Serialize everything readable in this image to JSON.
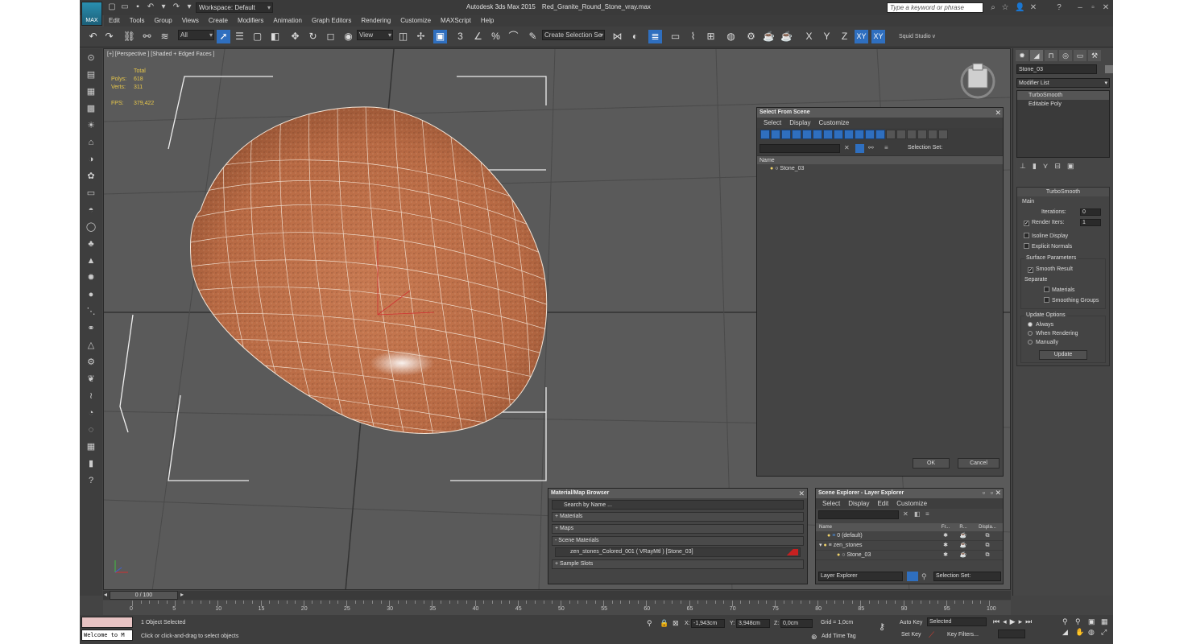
{
  "app": {
    "title": "Autodesk 3ds Max  2015",
    "file": "Red_Granite_Round_Stone_vray.max",
    "workspace": "Workspace: Default",
    "search_placeholder": "Type a keyword or phrase",
    "logo": "MAX"
  },
  "menu": [
    "Edit",
    "Tools",
    "Group",
    "Views",
    "Create",
    "Modifiers",
    "Animation",
    "Graph Editors",
    "Rendering",
    "Customize",
    "MAXScript",
    "Help"
  ],
  "toolbar": {
    "filter": "All",
    "refcoord": "View",
    "selset_placeholder": "Create Selection Se",
    "studio": "Squid Studio v",
    "axes": [
      "X",
      "Y",
      "Z",
      "XY",
      "XY"
    ]
  },
  "viewport": {
    "label": "[+] [Perspective ] [Shaded + Edged Faces ]",
    "stats_header": "Total",
    "polys_label": "Polys:",
    "polys": "618",
    "verts_label": "Verts:",
    "verts": "311",
    "fps_label": "FPS:",
    "fps": "379,422"
  },
  "select_scene": {
    "title": "Select From Scene",
    "menu": [
      "Select",
      "Display",
      "Customize"
    ],
    "selection_set": "Selection Set:",
    "col_name": "Name",
    "items": [
      "Stone_03"
    ],
    "ok": "OK",
    "cancel": "Cancel"
  },
  "material_browser": {
    "title": "Material/Map Browser",
    "search": "Search by Name ...",
    "sections": [
      "+ Materials",
      "+ Maps",
      "- Scene Materials"
    ],
    "scene_material": "zen_stones_Colored_001  ( VRayMtl )  [Stone_03]",
    "sample_slots": "+ Sample Slots"
  },
  "scene_explorer": {
    "title": "Scene Explorer - Layer Explorer",
    "menu": [
      "Select",
      "Display",
      "Edit",
      "Customize"
    ],
    "cols": [
      "Name",
      "Fr...",
      "R...",
      "Displa..."
    ],
    "rows": [
      "0 (default)",
      "zen_stones",
      "Stone_03"
    ],
    "footer_combo": "Layer Explorer",
    "footer_sel": "Selection Set:"
  },
  "command_panel": {
    "object_name": "Stone_03",
    "modifier_list": "Modifier List",
    "stack": [
      "TurboSmooth",
      "Editable Poly"
    ],
    "rollout_title": "TurboSmooth",
    "main": "Main",
    "iterations_label": "Iterations:",
    "iterations": "0",
    "render_iters_label": "Render Iters:",
    "render_iters": "1",
    "isoline": "Isoline Display",
    "explicit": "Explicit Normals",
    "surface_params": "Surface Parameters",
    "smooth_result": "Smooth Result",
    "separate": "Separate",
    "materials": "Materials",
    "smoothing_groups": "Smoothing Groups",
    "update_options": "Update Options",
    "always": "Always",
    "when_rendering": "When Rendering",
    "manually": "Manually",
    "update": "Update"
  },
  "timeline": {
    "slider": "0 / 100",
    "ticks": [
      "0",
      "5",
      "10",
      "15",
      "20",
      "25",
      "30",
      "35",
      "40",
      "45",
      "50",
      "55",
      "60",
      "65",
      "70",
      "75",
      "80",
      "85",
      "90",
      "95",
      "100"
    ]
  },
  "status": {
    "maxscript": "Welcome to M",
    "selected": "1 Object Selected",
    "prompt": "Click or click-and-drag to select objects",
    "x_label": "X:",
    "x": "-1,943cm",
    "y_label": "Y:",
    "y": "3,948cm",
    "z_label": "Z:",
    "z": "0,0cm",
    "grid": "Grid = 1,0cm",
    "add_time_tag": "Add Time Tag",
    "auto_key": "Auto Key",
    "set_key": "Set Key",
    "key_sel": "Selected",
    "key_filters": "Key Filters..."
  },
  "colors": {
    "accent": "#2f6fbf",
    "stats": "#e8c84a",
    "stone": "#c4704a"
  }
}
